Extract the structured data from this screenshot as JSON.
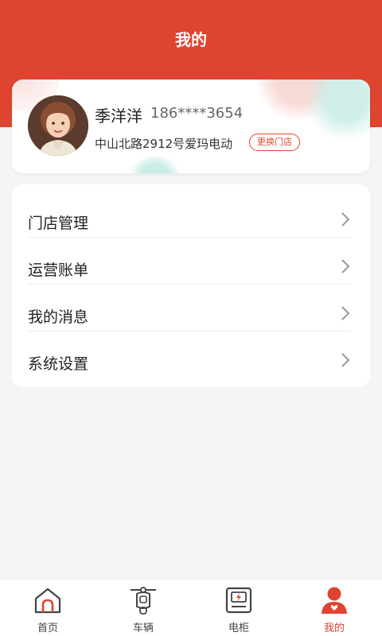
{
  "header": {
    "title": "我的"
  },
  "profile": {
    "name": "季洋洋",
    "phone": "186****3654",
    "store": "中山北路2912号爱玛电动",
    "change_store_label": "更换门店"
  },
  "menu": {
    "items": [
      {
        "label": "门店管理",
        "icon": "chevron-right-icon"
      },
      {
        "label": "运营账单",
        "icon": "chevron-right-icon"
      },
      {
        "label": "我的消息",
        "icon": "chevron-right-icon"
      },
      {
        "label": "系统设置",
        "icon": "chevron-right-icon"
      }
    ]
  },
  "tabbar": {
    "items": [
      {
        "label": "首页",
        "icon": "home-icon",
        "active": false
      },
      {
        "label": "车辆",
        "icon": "scooter-icon",
        "active": false
      },
      {
        "label": "电柜",
        "icon": "battery-cabinet-icon",
        "active": false
      },
      {
        "label": "我的",
        "icon": "user-icon",
        "active": true
      }
    ]
  },
  "colors": {
    "brand": "#df4430",
    "background": "#f5f5f5",
    "card": "#ffffff",
    "text_primary": "#222222",
    "text_secondary": "#666666"
  }
}
